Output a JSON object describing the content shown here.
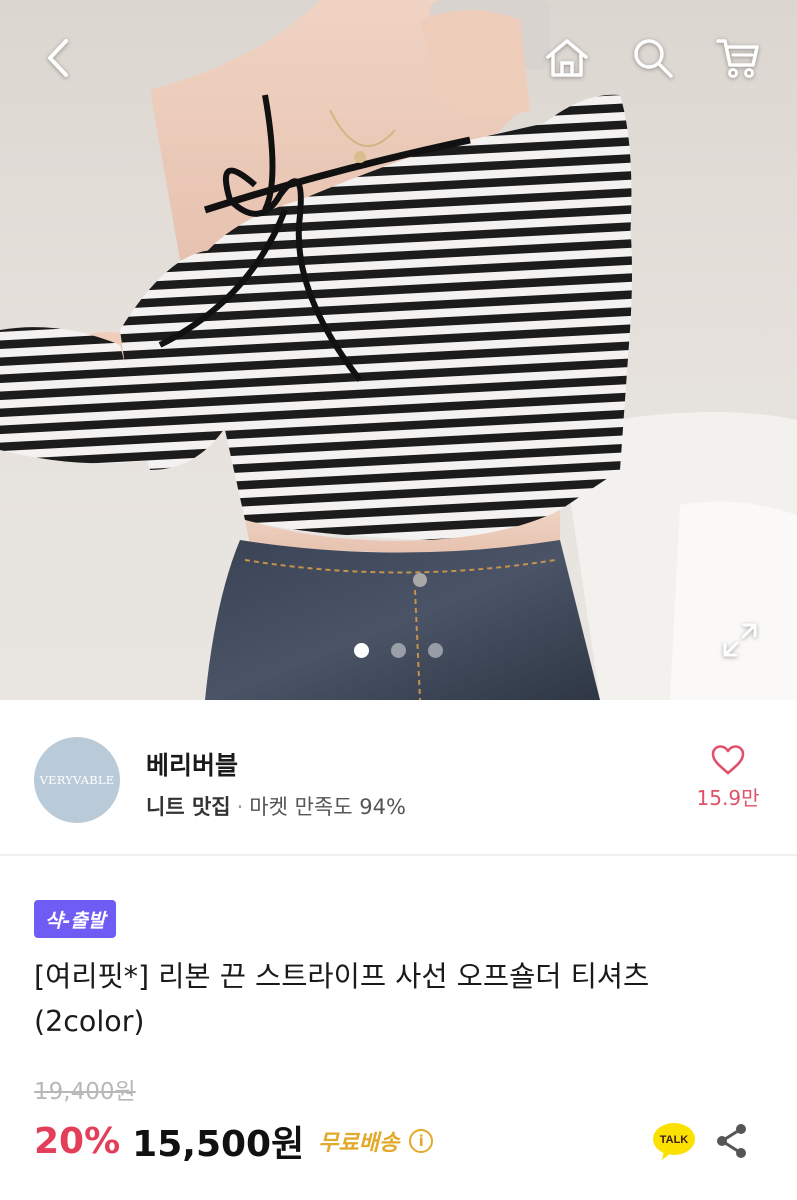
{
  "hero": {
    "image_alt": "striped off-shoulder ribbon tee worn with dark jeans",
    "page_count": 3,
    "active_page": 1
  },
  "header": {
    "back_icon": "chevron-left-icon",
    "home_icon": "home-icon",
    "search_icon": "search-icon",
    "cart_icon": "cart-icon"
  },
  "seller": {
    "logo_text": "VERYVABLE",
    "name": "베리버블",
    "tag": "니트 맛집",
    "separator": "·",
    "satisfaction": "마켓 만족도 94%",
    "likes": "15.9만"
  },
  "product": {
    "badge": "샥-출발",
    "title": "[여리핏*] 리본 끈 스트라이프 사선 오프숄더 티셔츠 (2color)",
    "original_price": "19,400원",
    "discount": "20%",
    "price": "15,500원",
    "shipping": "무료배송",
    "shipping_info": "i",
    "talk_label": "TALK"
  },
  "colors": {
    "accent_pink": "#e43f5a",
    "badge_purple": "#6e5cf5",
    "shipping_yellow": "#e2a92a",
    "kakao_yellow": "#fae100"
  }
}
